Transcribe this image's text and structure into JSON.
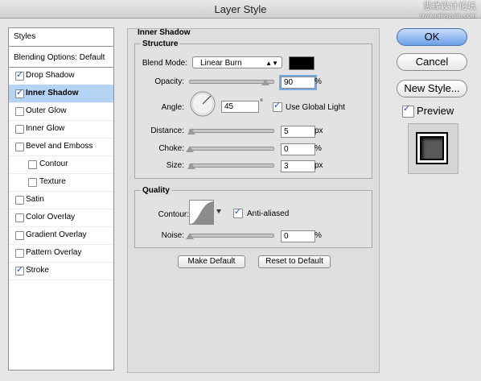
{
  "window": {
    "title": "Layer Style",
    "watermark_line1": "思缘设计论坛",
    "watermark_line2": "www.missyuan.com"
  },
  "styles_list": {
    "header": "Styles",
    "blending": "Blending Options: Default",
    "items": [
      {
        "label": "Drop Shadow",
        "checked": true,
        "selected": false,
        "sub": false
      },
      {
        "label": "Inner Shadow",
        "checked": true,
        "selected": true,
        "sub": false
      },
      {
        "label": "Outer Glow",
        "checked": false,
        "selected": false,
        "sub": false
      },
      {
        "label": "Inner Glow",
        "checked": false,
        "selected": false,
        "sub": false
      },
      {
        "label": "Bevel and Emboss",
        "checked": false,
        "selected": false,
        "sub": false
      },
      {
        "label": "Contour",
        "checked": false,
        "selected": false,
        "sub": true
      },
      {
        "label": "Texture",
        "checked": false,
        "selected": false,
        "sub": true
      },
      {
        "label": "Satin",
        "checked": false,
        "selected": false,
        "sub": false
      },
      {
        "label": "Color Overlay",
        "checked": false,
        "selected": false,
        "sub": false
      },
      {
        "label": "Gradient Overlay",
        "checked": false,
        "selected": false,
        "sub": false
      },
      {
        "label": "Pattern Overlay",
        "checked": false,
        "selected": false,
        "sub": false
      },
      {
        "label": "Stroke",
        "checked": true,
        "selected": false,
        "sub": false
      }
    ]
  },
  "panel": {
    "title": "Inner Shadow",
    "structure": {
      "title": "Structure",
      "blend_mode_label": "Blend Mode:",
      "blend_mode_value": "Linear Burn",
      "shadow_color": "#000000",
      "opacity_label": "Opacity:",
      "opacity_value": "90",
      "opacity_unit": "%",
      "opacity_level": 0.9,
      "angle_label": "Angle:",
      "angle_value": "45",
      "angle_unit": "°",
      "global_light_label": "Use Global Light",
      "global_light_checked": true,
      "distance_label": "Distance:",
      "distance_value": "5",
      "distance_unit": "px",
      "distance_level": 0.02,
      "choke_label": "Choke:",
      "choke_value": "0",
      "choke_unit": "%",
      "choke_level": 0,
      "size_label": "Size:",
      "size_value": "3",
      "size_unit": "px",
      "size_level": 0.015
    },
    "quality": {
      "title": "Quality",
      "contour_label": "Contour:",
      "anti_aliased_label": "Anti-aliased",
      "anti_aliased_checked": true,
      "noise_label": "Noise:",
      "noise_value": "0",
      "noise_unit": "%",
      "noise_level": 0
    },
    "make_default": "Make Default",
    "reset_default": "Reset to Default"
  },
  "buttons": {
    "ok": "OK",
    "cancel": "Cancel",
    "new_style": "New Style...",
    "preview": "Preview",
    "preview_checked": true
  }
}
